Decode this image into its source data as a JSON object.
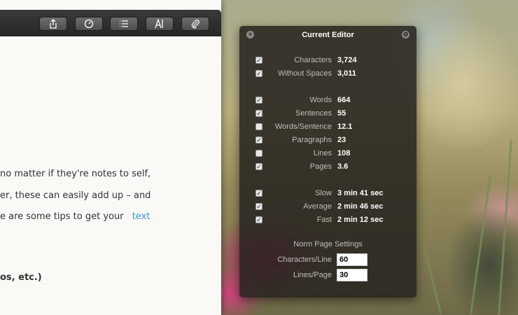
{
  "editor": {
    "toolbar": [
      {
        "name": "share-icon"
      },
      {
        "name": "gauge-icon"
      },
      {
        "name": "list-icon"
      },
      {
        "name": "text-cursor-icon"
      },
      {
        "name": "paperclip-icon"
      }
    ],
    "lines": [
      {
        "text": "no matter if they're notes to self,",
        "link": ""
      },
      {
        "text": "er, these can easily add up – and",
        "link": ""
      },
      {
        "text": "e are some tips to get your",
        "link": "text"
      },
      {
        "text": "os, etc.)",
        "link": ""
      }
    ]
  },
  "panel": {
    "title": "Current Editor",
    "close_icon": "close-icon",
    "settings_icon": "settings-icon",
    "stats": [
      {
        "label": "Characters",
        "value": "3,724",
        "checked": true
      },
      {
        "label": "Without Spaces",
        "value": "3,011",
        "checked": true
      },
      {
        "label": "Words",
        "value": "664",
        "checked": true
      },
      {
        "label": "Sentences",
        "value": "55",
        "checked": true
      },
      {
        "label": "Words/Sentence",
        "value": "12.1",
        "checked": false
      },
      {
        "label": "Paragraphs",
        "value": "23",
        "checked": true
      },
      {
        "label": "Lines",
        "value": "108",
        "checked": false
      },
      {
        "label": "Pages",
        "value": "3.6",
        "checked": true
      },
      {
        "label": "Slow",
        "value": "3 min 41 sec",
        "checked": true
      },
      {
        "label": "Average",
        "value": "2 min 46 sec",
        "checked": true
      },
      {
        "label": "Fast",
        "value": "2 min 12 sec",
        "checked": true
      }
    ],
    "norm_settings": {
      "title": "Norm Page Settings",
      "chars_per_line_label": "Characters/Line",
      "chars_per_line_value": "60",
      "lines_per_page_label": "Lines/Page",
      "lines_per_page_value": "30"
    }
  },
  "colors": {
    "link": "#2e9ad0",
    "panel_bg": "#28241f",
    "editor_bg": "#fbf9f6"
  }
}
